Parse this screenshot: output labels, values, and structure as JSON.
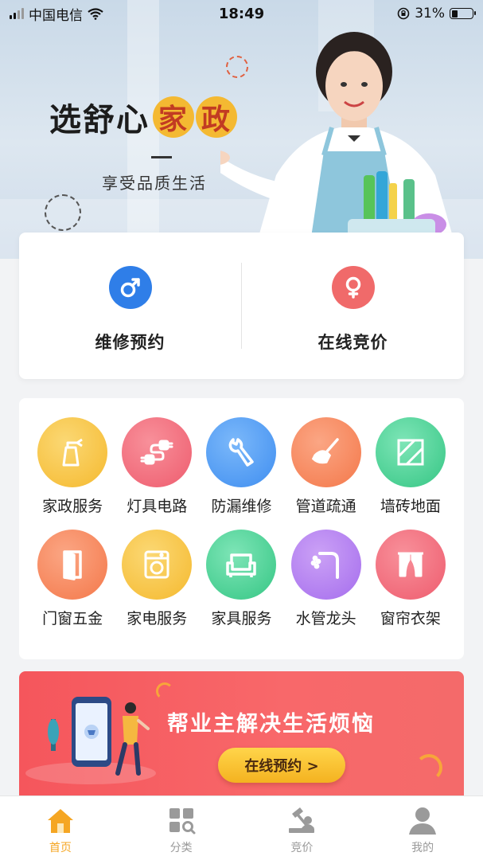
{
  "status_bar": {
    "carrier": "中国电信",
    "time": "18:49",
    "battery": "31%",
    "battery_level": 0.31,
    "icons": [
      "signal-icon",
      "wifi-icon",
      "rotation-lock-icon",
      "battery-icon"
    ]
  },
  "hero": {
    "title_plain": "选舒心",
    "title_circled": [
      "家",
      "政"
    ],
    "subtitle": "享受品质生活"
  },
  "actions": [
    {
      "label": "维修预约",
      "icon": "male-symbol-icon",
      "color": "#2f7ee8"
    },
    {
      "label": "在线竞价",
      "icon": "female-symbol-icon",
      "color": "#f06a6a"
    }
  ],
  "services": [
    {
      "label": "家政服务",
      "icon": "spray-bottle-icon",
      "color": "#f7c544"
    },
    {
      "label": "灯具电路",
      "icon": "plug-icon",
      "color": "#f26b7a"
    },
    {
      "label": "防漏维修",
      "icon": "wrench-icon",
      "color": "#4f9ef5"
    },
    {
      "label": "管道疏通",
      "icon": "plunger-icon",
      "color": "#f7875a"
    },
    {
      "label": "墙砖地面",
      "icon": "tile-icon",
      "color": "#4fd49a"
    },
    {
      "label": "门窗五金",
      "icon": "door-icon",
      "color": "#f7875a"
    },
    {
      "label": "家电服务",
      "icon": "washing-machine-icon",
      "color": "#f7c544"
    },
    {
      "label": "家具服务",
      "icon": "sofa-icon",
      "color": "#4fd49a"
    },
    {
      "label": "水管龙头",
      "icon": "faucet-icon",
      "color": "#b77ff0"
    },
    {
      "label": "窗帘衣架",
      "icon": "curtain-icon",
      "color": "#f26b7a"
    }
  ],
  "promo": {
    "text": "帮业主解决生活烦恼",
    "button": "在线预约 >"
  },
  "tabbar": {
    "active_color": "#f5a623",
    "inactive_color": "#9a9a9a",
    "tabs": [
      {
        "label": "首页",
        "icon": "home-icon",
        "active": true
      },
      {
        "label": "分类",
        "icon": "category-icon",
        "active": false
      },
      {
        "label": "竞价",
        "icon": "bidding-icon",
        "active": false
      },
      {
        "label": "我的",
        "icon": "user-icon",
        "active": false
      }
    ]
  }
}
